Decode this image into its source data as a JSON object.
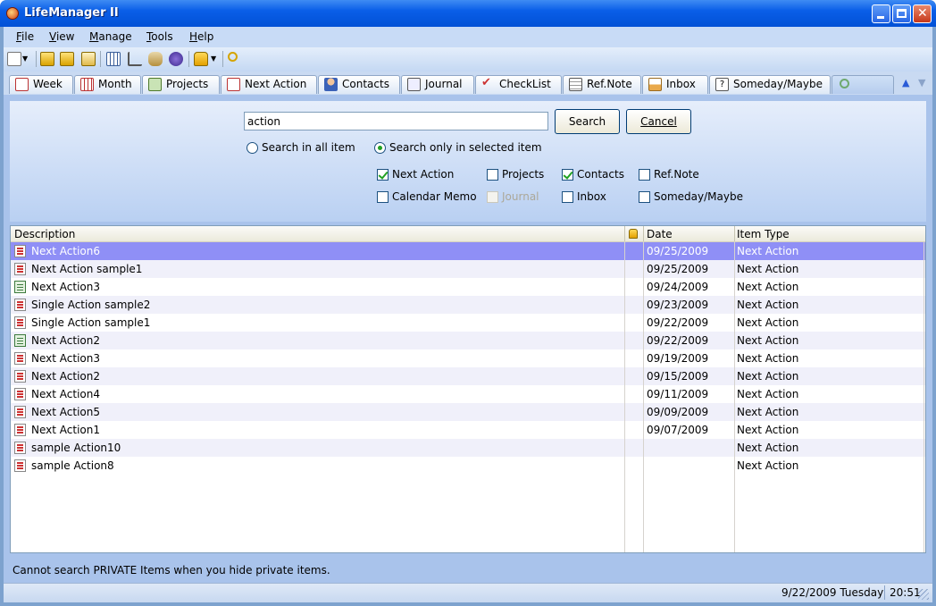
{
  "window": {
    "title": "LifeManager II"
  },
  "menu": [
    {
      "label": "File",
      "key": "F",
      "rest": "ile"
    },
    {
      "label": "View",
      "key": "V",
      "rest": "iew"
    },
    {
      "label": "Manage",
      "key": "M",
      "rest": "anage"
    },
    {
      "label": "Tools",
      "key": "T",
      "rest": "ools"
    },
    {
      "label": "Help",
      "key": "H",
      "rest": "elp"
    }
  ],
  "toolbar_icons": [
    "new-icon",
    "dropdown-arrow-icon",
    "import-icon",
    "export-icon",
    "backup-icon",
    "calendar-grid-icon",
    "tree-icon",
    "database-icon",
    "settings-icon",
    "lock-icon",
    "dropdown-arrow-icon",
    "search-icon"
  ],
  "tabs": [
    {
      "label": "Week",
      "icon": "week-calendar-icon"
    },
    {
      "label": "Month",
      "icon": "month-calendar-icon"
    },
    {
      "label": "Projects",
      "icon": "projects-icon"
    },
    {
      "label": "Next Action",
      "icon": "next-action-icon"
    },
    {
      "label": "Contacts",
      "icon": "contacts-icon"
    },
    {
      "label": "Journal",
      "icon": "journal-icon"
    },
    {
      "label": "CheckList",
      "icon": "checklist-icon"
    },
    {
      "label": "Ref.Note",
      "icon": "ref-note-icon"
    },
    {
      "label": "Inbox",
      "icon": "inbox-icon"
    },
    {
      "label": "Someday/Maybe",
      "icon": "someday-maybe-icon"
    }
  ],
  "search": {
    "query": "action",
    "search_button": "Search",
    "cancel_button": "Cancel",
    "scope_all": "Search in all item",
    "scope_selected": "Search only in selected item",
    "scope_value": "selected",
    "filters": [
      {
        "label": "Next Action",
        "checked": true,
        "enabled": true
      },
      {
        "label": "Projects",
        "checked": false,
        "enabled": true
      },
      {
        "label": "Contacts",
        "checked": true,
        "enabled": true
      },
      {
        "label": "Ref.Note",
        "checked": false,
        "enabled": true
      },
      {
        "label": "Calendar Memo",
        "checked": false,
        "enabled": true
      },
      {
        "label": "Journal",
        "checked": false,
        "enabled": false
      },
      {
        "label": "Inbox",
        "checked": false,
        "enabled": true
      },
      {
        "label": "Someday/Maybe",
        "checked": false,
        "enabled": true
      }
    ]
  },
  "results": {
    "headers": {
      "description": "Description",
      "date": "Date",
      "type": "Item Type"
    },
    "rows": [
      {
        "description": "Next Action6",
        "date": "09/25/2009",
        "type": "Next Action",
        "icon": "note-icon",
        "selected": true
      },
      {
        "description": "Next Action sample1",
        "date": "09/25/2009",
        "type": "Next Action",
        "icon": "note-icon"
      },
      {
        "description": "Next Action3",
        "date": "09/24/2009",
        "type": "Next Action",
        "icon": "memo-icon"
      },
      {
        "description": "Single Action sample2",
        "date": "09/23/2009",
        "type": "Next Action",
        "icon": "note-icon"
      },
      {
        "description": "Single Action sample1",
        "date": "09/22/2009",
        "type": "Next Action",
        "icon": "note-icon"
      },
      {
        "description": "Next Action2",
        "date": "09/22/2009",
        "type": "Next Action",
        "icon": "memo-icon"
      },
      {
        "description": "Next Action3",
        "date": "09/19/2009",
        "type": "Next Action",
        "icon": "note-icon"
      },
      {
        "description": "Next Action2",
        "date": "09/15/2009",
        "type": "Next Action",
        "icon": "note-icon"
      },
      {
        "description": "Next Action4",
        "date": "09/11/2009",
        "type": "Next Action",
        "icon": "note-icon"
      },
      {
        "description": "Next Action5",
        "date": "09/09/2009",
        "type": "Next Action",
        "icon": "note-icon"
      },
      {
        "description": "Next Action1",
        "date": "09/07/2009",
        "type": "Next Action",
        "icon": "note-icon"
      },
      {
        "description": "sample Action10",
        "date": "",
        "type": "Next Action",
        "icon": "note-icon"
      },
      {
        "description": "sample Action8",
        "date": "",
        "type": "Next Action",
        "icon": "note-icon"
      }
    ]
  },
  "status": {
    "message": "Cannot search PRIVATE Items when you hide private items.",
    "date": "9/22/2009 Tuesday",
    "time": "20:51"
  },
  "colors": {
    "selection": "#8f8ff6",
    "title_bar": "#0a5ee8"
  }
}
